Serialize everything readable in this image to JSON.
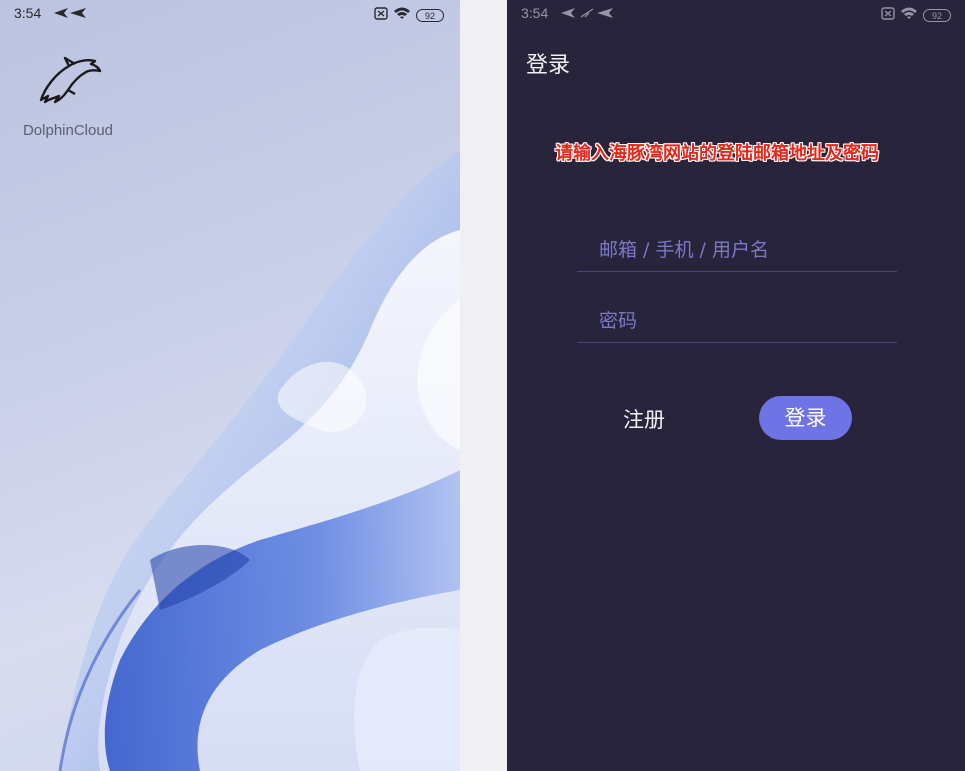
{
  "left_screen": {
    "status_bar": {
      "time": "3:54",
      "battery": "92"
    },
    "app": {
      "name": "DolphinCloud",
      "icon": "dolphin-icon"
    }
  },
  "right_screen": {
    "status_bar": {
      "time": "3:54",
      "battery": "92"
    },
    "title": "登录",
    "hint": "请输入海豚湾网站的登陆邮箱地址及密码",
    "username_placeholder": "邮箱 / 手机 / 用户名",
    "password_placeholder": "密码",
    "register_label": "注册",
    "login_label": "登录",
    "colors": {
      "background": "#28243b",
      "accent": "#6e73e6",
      "hint": "#e8261a"
    }
  }
}
